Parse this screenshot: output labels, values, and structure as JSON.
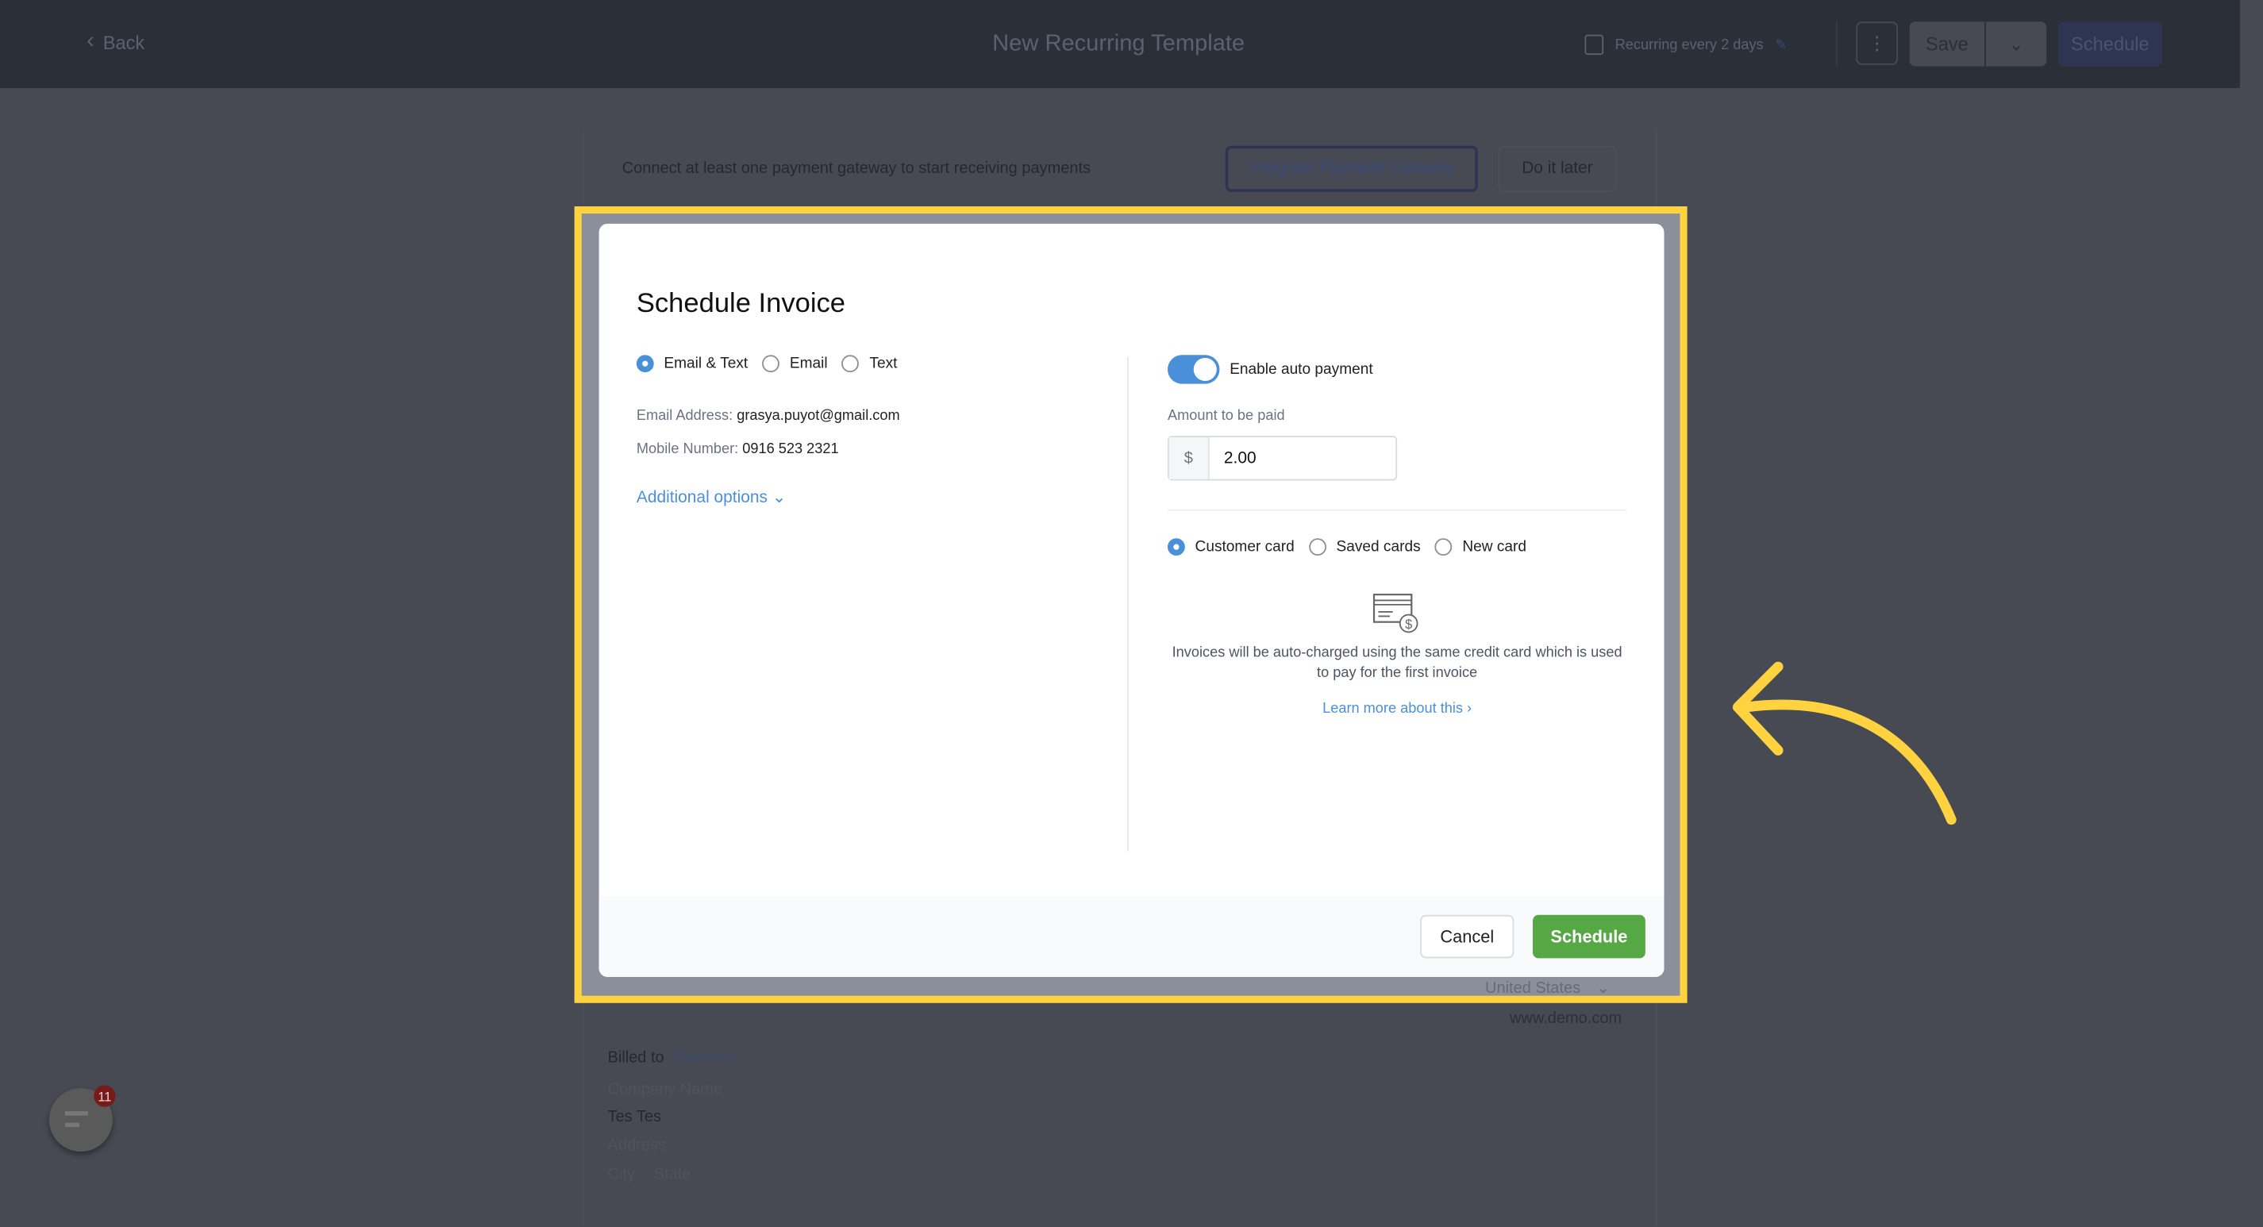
{
  "header": {
    "back_label": "Back",
    "title": "New Recurring Template",
    "recurring_label": "Recurring every 2 days",
    "save_label": "Save",
    "schedule_label": "Schedule"
  },
  "banner": {
    "text": "Connect at least one payment gateway to start receiving payments",
    "integrate_label": "Integrate Payment Gateway",
    "later_label": "Do it later"
  },
  "background_form": {
    "country": "United States",
    "website": "www.demo.com",
    "billed_to_label": "Billed to",
    "remove_label": "Remove",
    "company_placeholder": "Company Name",
    "customer_name": "Tes Tes",
    "address_placeholder": "Address",
    "city_placeholder": "City",
    "state_placeholder": "State"
  },
  "modal": {
    "title": "Schedule Invoice",
    "send_options": [
      {
        "label": "Email & Text",
        "selected": true
      },
      {
        "label": "Email",
        "selected": false
      },
      {
        "label": "Text",
        "selected": false
      }
    ],
    "email_label": "Email Address:",
    "email_value": "grasya.puyot@gmail.com",
    "mobile_label": "Mobile Number:",
    "mobile_value": "0916 523 2321",
    "additional_options_label": "Additional options",
    "auto_payment_label": "Enable auto payment",
    "auto_payment_enabled": true,
    "amount_label": "Amount to be paid",
    "currency_symbol": "$",
    "amount_value": "2.00",
    "card_options": [
      {
        "label": "Customer card",
        "selected": true
      },
      {
        "label": "Saved cards",
        "selected": false
      },
      {
        "label": "New card",
        "selected": false
      }
    ],
    "info_text": "Invoices will be auto-charged using the same credit card which is used to pay for the first invoice",
    "learn_more_label": "Learn more about this",
    "cancel_label": "Cancel",
    "schedule_label": "Schedule"
  },
  "chat": {
    "badge_count": "11"
  },
  "colors": {
    "accent": "#4a90d9",
    "highlight": "#ffd23f",
    "primary_button": "#55a843"
  }
}
